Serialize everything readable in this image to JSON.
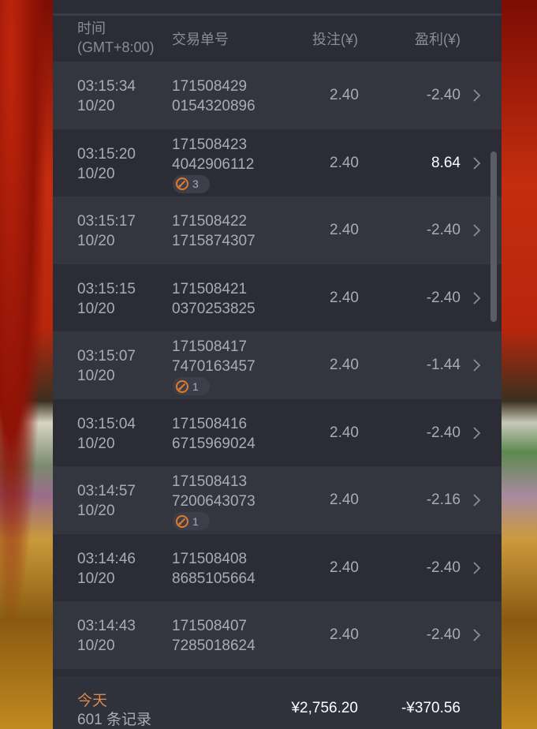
{
  "header": {
    "time_line1": "时间",
    "time_line2": "(GMT+8:00)",
    "order": "交易单号",
    "bet": "投注(¥)",
    "profit": "盈利(¥)"
  },
  "rows": [
    {
      "time": "03:15:34",
      "date": "10/20",
      "order1": "171508429",
      "order2": "0154320896",
      "bet": "2.40",
      "profit": "-2.40",
      "badge": null
    },
    {
      "time": "03:15:20",
      "date": "10/20",
      "order1": "171508423",
      "order2": "4042906112",
      "bet": "2.40",
      "profit": "8.64",
      "badge": "3"
    },
    {
      "time": "03:15:17",
      "date": "10/20",
      "order1": "171508422",
      "order2": "1715874307",
      "bet": "2.40",
      "profit": "-2.40",
      "badge": null
    },
    {
      "time": "03:15:15",
      "date": "10/20",
      "order1": "171508421",
      "order2": "0370253825",
      "bet": "2.40",
      "profit": "-2.40",
      "badge": null
    },
    {
      "time": "03:15:07",
      "date": "10/20",
      "order1": "171508417",
      "order2": "7470163457",
      "bet": "2.40",
      "profit": "-1.44",
      "badge": "1"
    },
    {
      "time": "03:15:04",
      "date": "10/20",
      "order1": "171508416",
      "order2": "6715969024",
      "bet": "2.40",
      "profit": "-2.40",
      "badge": null
    },
    {
      "time": "03:14:57",
      "date": "10/20",
      "order1": "171508413",
      "order2": "7200643073",
      "bet": "2.40",
      "profit": "-2.16",
      "badge": "1"
    },
    {
      "time": "03:14:46",
      "date": "10/20",
      "order1": "171508408",
      "order2": "8685105664",
      "bet": "2.40",
      "profit": "-2.40",
      "badge": null
    },
    {
      "time": "03:14:43",
      "date": "10/20",
      "order1": "171508407",
      "order2": "7285018624",
      "bet": "2.40",
      "profit": "-2.40",
      "badge": null
    }
  ],
  "footer": {
    "today": "今天",
    "count": "601 条记录",
    "total_bet": "¥2,756.20",
    "total_profit": "-¥370.56"
  },
  "colors": {
    "panel_bg": "#2b2c35",
    "row_alt_bg": "#34363f",
    "text": "#a9abb5",
    "positive_profit": "#ffffff",
    "today_accent": "#d98a4a",
    "badge_icon": "#e07a2c"
  },
  "icons": {
    "row_chevron": "chevron-right-icon",
    "badge": "free-spin-icon"
  }
}
